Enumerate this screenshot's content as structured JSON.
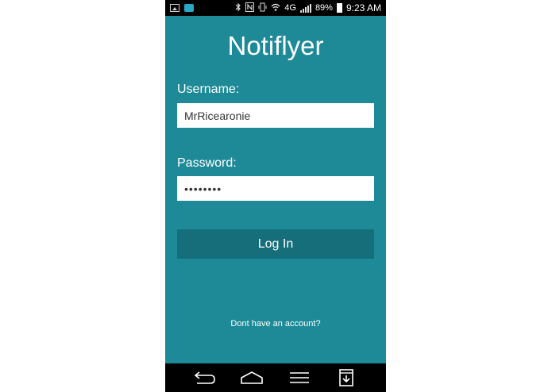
{
  "status_bar": {
    "notification_icons": [
      "image-icon",
      "mail-icon"
    ],
    "system_icons": [
      "bluetooth-icon",
      "nfc-icon",
      "vibrate-icon",
      "wifi-icon",
      "lte-icon",
      "signal-icon"
    ],
    "network_label": "4G",
    "battery_percent": "89%",
    "time": "9:23 AM"
  },
  "app": {
    "title": "Notiflyer",
    "username_label": "Username:",
    "username_value": "MrRicearonie",
    "password_label": "Password:",
    "password_value": "••••••••",
    "login_label": "Log In",
    "signup_link": "Dont have an account?"
  },
  "nav_bar": {
    "buttons": [
      "back-icon",
      "home-icon",
      "menu-icon",
      "download-icon"
    ]
  },
  "colors": {
    "background": "#1e8a98",
    "button": "#176e7b",
    "input_background": "#ffffff",
    "text": "#ffffff"
  }
}
